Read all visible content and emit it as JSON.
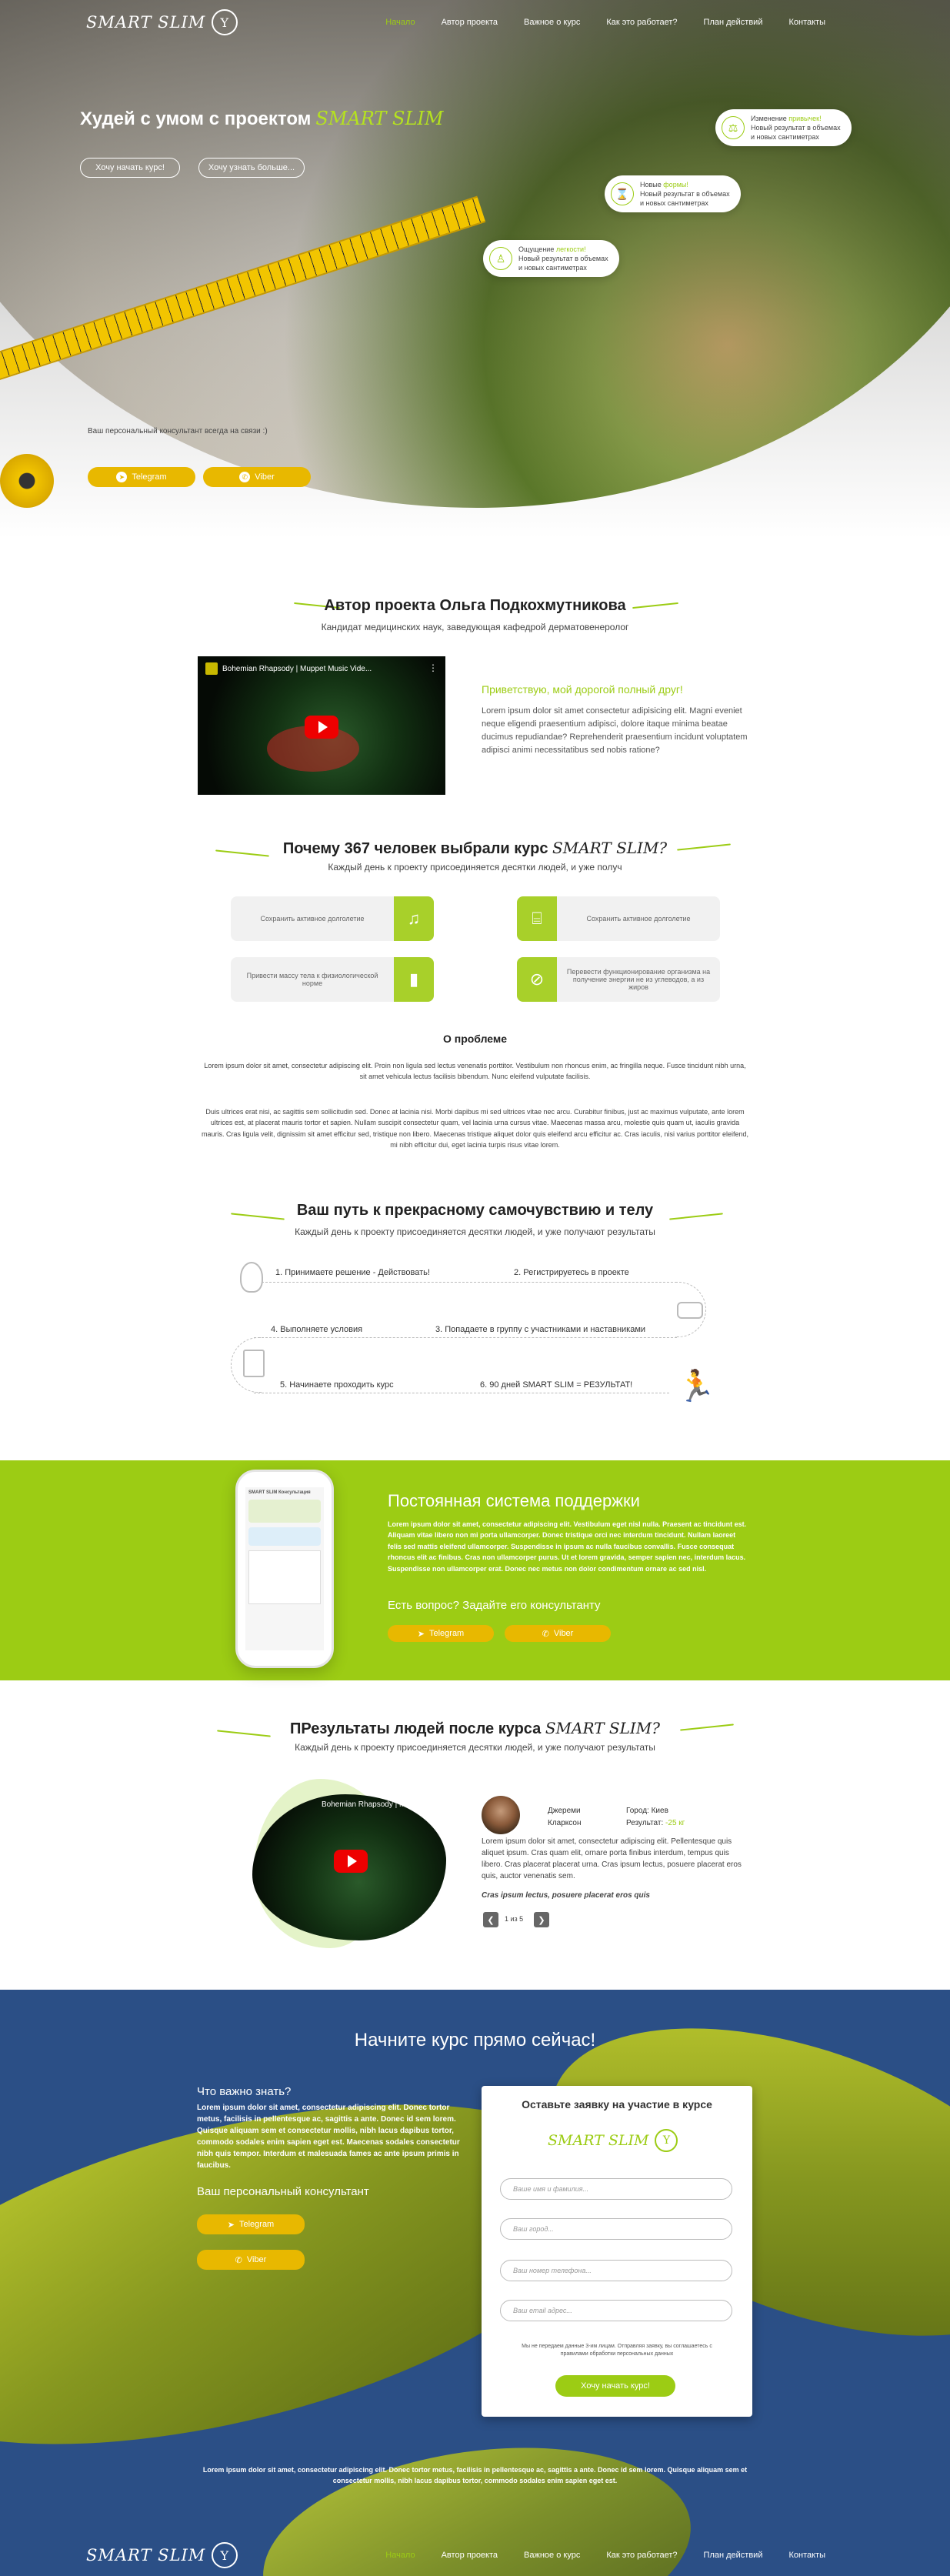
{
  "nav": {
    "logo": "SMART SLIM",
    "items": [
      "Начало",
      "Автор проекта",
      "Важное о курс",
      "Как это работает?",
      "План действий",
      "Контакты"
    ]
  },
  "hero": {
    "title": "Худей с умом с проектом",
    "brand": "SMART SLIM",
    "btn1": "Хочу начать курс!",
    "btn2": "Хочу узнать больше...",
    "bubbles": [
      {
        "l1a": "Изменение",
        "l1b": "привычек!",
        "l2": "Новый результат в объемах",
        "l3": "и новых сантиметрах"
      },
      {
        "l1a": "Новые",
        "l1b": "формы!",
        "l2": "Новый результат в объемах",
        "l3": "и новых сантиметрах"
      },
      {
        "l1a": "Ощущение",
        "l1b": "легкости!",
        "l2": "Новый результат в объемах",
        "l3": "и новых сантиметрах"
      }
    ],
    "consult": "Ваш персональный консультант всегда на связи :)",
    "telegram": "Telegram",
    "viber": "Viber"
  },
  "author": {
    "title": "Автор проекта Ольга Подкохмутникова",
    "sub": "Кандидат медицинских наук, заведующая кафедрой дерматовенеролог",
    "video_title": "Bohemian Rhapsody | Muppet Music Vide...",
    "greet": "Приветствую, мой дорогой полный друг!",
    "text": "Lorem ipsum dolor sit amet consectetur adipisicing elit. Magni eveniet neque eligendi praesentium adipisci, dolore itaque minima beatae ducimus repudiandae? Reprehenderit praesentium incidunt voluptatem adipisci animi necessitatibus sed nobis ratione?"
  },
  "why": {
    "title": "Почему 367 человек выбрали курс",
    "brand": "SMART SLIM?",
    "sub": "Каждый день к проекту присоединяется десятки людей, и уже получ",
    "cards": [
      "Сохранить активное долголетие",
      "Сохранить активное долголетие",
      "Привести массу тела к физиологической норме",
      "Перевести функционирование организма на получение энергии не из углеводов, а из жиров"
    ],
    "problem_title": "О проблеме",
    "p1": "Lorem ipsum dolor sit amet, consectetur adipiscing elit. Proin non ligula sed lectus venenatis porttitor. Vestibulum non rhoncus enim, ac fringilla neque. Fusce tincidunt nibh urna, sit amet vehicula lectus facilisis bibendum. Nunc eleifend vulputate facilisis.",
    "p2": "Duis ultrices erat nisi, ac sagittis sem sollicitudin sed. Donec at lacinia nisi. Morbi dapibus mi sed ultrices vitae nec arcu. Curabitur finibus, just ac maximus vulputate, ante lorem ultrices est, at placerat mauris tortor et sapien. Nullam suscipit consectetur quam, vel lacinia urna cursus vitae. Maecenas massa arcu, molestie quis quam ut, iaculis gravida mauris. Cras ligula velit, dignissim sit amet efficitur sed, tristique non libero. Maecenas tristique aliquet dolor quis eleifend arcu efficitur ac. Cras iaculis, nisi varius porttitor eleifend, mi nibh efficitur dui, eget lacinia turpis risus vitae lorem."
  },
  "path": {
    "title": "Ваш путь к прекрасному самочувствию и телу",
    "sub": "Каждый день к проекту присоединяется десятки людей, и уже получают результаты",
    "steps": [
      "1. Принимаете решение - Действовать!",
      "2. Регистрируетесь в проекте",
      "3. Попадаете в группу с участниками и наставниками",
      "4. Выполняете условия",
      "5. Начинаете проходить курс",
      "6. 90 дней SMART SLIM = РЕЗУЛЬТАТ!"
    ]
  },
  "support": {
    "title": "Постоянная система поддержки",
    "text": "Lorem ipsum dolor sit amet, consectetur adipiscing elit. Vestibulum eget nisl nulla. Praesent ac tincidunt est. Aliquam vitae libero non mi porta ullamcorper. Donec tristique orci nec interdum tincidunt. Nullam laoreet felis sed mattis eleifend ullamcorper. Suspendisse in ipsum ac nulla faucibus convallis. Fusce consequat rhoncus elit ac finibus. Cras non ullamcorper purus. Ut et lorem gravida, semper sapien nec, interdum lacus. Suspendisse non ullamcorper erat. Donec nec metus non dolor condimentum ornare ac sed nisl.",
    "question": "Есть вопрос? Задайте его консультанту",
    "telegram": "Telegram",
    "viber": "Viber",
    "phone_title": "SMART SLIM Консультация"
  },
  "results": {
    "title": "ПРезультаты людей после курса",
    "brand": "SMART SLIM?",
    "sub": "Каждый день к проекту присоединяется десятки людей, и уже получают результаты",
    "name1": "Джереми",
    "name2": "Кларксон",
    "city_label": "Город:",
    "city": "Киев",
    "result_label": "Результат:",
    "result": "-25 кг",
    "text": "Lorem ipsum dolor sit amet, consectetur adipiscing elit. Pellentesque quis aliquet ipsum. Cras quam elit, ornare porta finibus interdum, tempus quis libero. Cras placerat placerat urna. Cras ipsum lectus, posuere placerat eros quis, auctor venenatis sem.",
    "quote": "Cras ipsum lectus, posuere placerat eros quis",
    "pager": "1 из 5",
    "video_title": "Bohemian Rhapsody | Muppe..."
  },
  "start": {
    "title": "Начните курс прямо сейчас!",
    "know": "Что важно знать?",
    "know_text": "Lorem ipsum dolor sit amet, consectetur adipiscing elit. Donec tortor metus, facilisis in pellentesque ac, sagittis a ante. Donec id sem lorem. Quisque aliquam sem et consectetur mollis, nibh lacus dapibus tortor, commodo sodales enim sapien eget est. Maecenas sodales consectetur nibh quis tempor. Interdum et malesuada fames ac ante ipsum primis in faucibus.",
    "consult": "Ваш персональный консультант",
    "telegram": "Telegram",
    "viber": "Viber",
    "form_title": "Оставьте заявку на участие в курсе",
    "form_logo": "SMART SLIM",
    "ph_name": "Ваше имя и фамилия...",
    "ph_city": "Ваш город...",
    "ph_phone": "Ваш номер телефона...",
    "ph_email": "Ваш email адрес...",
    "privacy": "Мы не передаем данные 3-им лицам. Отправляя заявку, вы соглашаетесь с правилами обработки персональных данных",
    "submit": "Хочу начать курс!",
    "footer_text": "Lorem ipsum dolor sit amet, consectetur adipiscing elit. Donec tortor metus, facilisis in pellentesque ac, sagittis a ante. Donec id sem lorem. Quisque aliquam sem et consectetur mollis, nibh lacus dapibus tortor, commodo sodales enim sapien eget est."
  },
  "colors": {
    "accent": "#9ccc14",
    "yellow": "#e8b800",
    "blue": "#2b4f86"
  }
}
